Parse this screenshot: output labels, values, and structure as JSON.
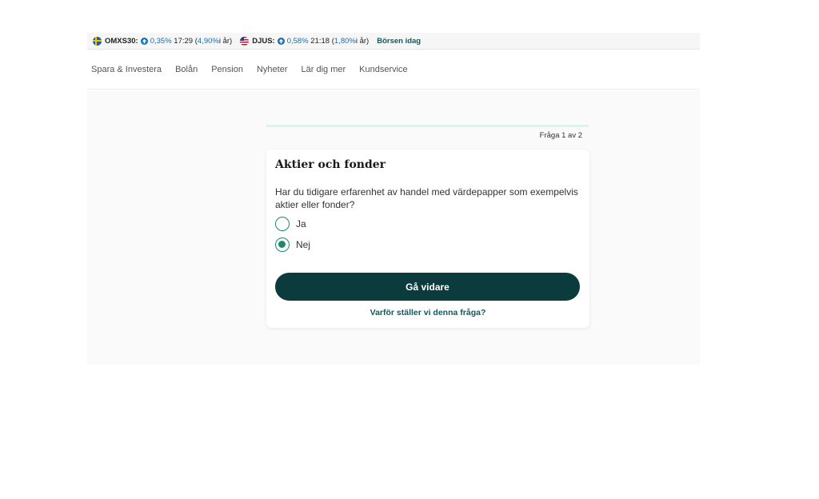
{
  "ticker": {
    "omx": {
      "name": "OMXS30:",
      "change": "0,35%",
      "time": "17:29",
      "open": "(",
      "year_change": "4,90%",
      "year_suffix": " i år)",
      "flag": "sweden-flag"
    },
    "djus": {
      "name": "DJUS:",
      "change": "0,58%",
      "time": "21:18",
      "open": "(",
      "year_change": "1,80%",
      "year_suffix": " i år)",
      "flag": "usa-flag"
    },
    "link": "Börsen idag"
  },
  "nav": {
    "items": [
      "Spara & Investera",
      "Bolån",
      "Pension",
      "Nyheter",
      "Lär dig mer",
      "Kundservice"
    ]
  },
  "quiz": {
    "step": "Fråga 1 av 2",
    "title": "Aktier och fonder",
    "question": "Har du tidigare erfarenhet av handel med värdepapper som exempelvis aktier eller fonder?",
    "options": [
      {
        "label": "Ja",
        "selected": false
      },
      {
        "label": "Nej",
        "selected": true
      }
    ],
    "button": "Gå vidare",
    "why_link": "Varför ställer vi denna fråga?"
  },
  "colors": {
    "accent": "#1b8a6b",
    "button": "#0b3b3c",
    "link": "#0b5c5e",
    "ticker_blue": "#1a6fb0"
  }
}
